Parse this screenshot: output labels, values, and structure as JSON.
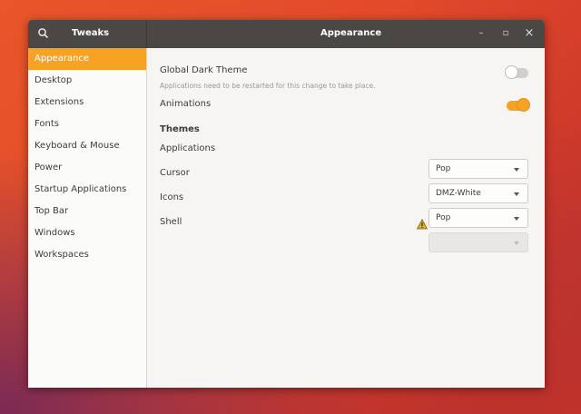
{
  "titlebar": {
    "app_title": "Tweaks",
    "page_title": "Appearance",
    "minimize": "–",
    "maximize": "▫",
    "close": "×"
  },
  "sidebar": {
    "items": [
      {
        "label": "Appearance",
        "active": true
      },
      {
        "label": "Desktop"
      },
      {
        "label": "Extensions"
      },
      {
        "label": "Fonts"
      },
      {
        "label": "Keyboard & Mouse"
      },
      {
        "label": "Power"
      },
      {
        "label": "Startup Applications"
      },
      {
        "label": "Top Bar"
      },
      {
        "label": "Windows"
      },
      {
        "label": "Workspaces"
      }
    ]
  },
  "settings": {
    "dark_theme": {
      "label": "Global Dark Theme",
      "note": "Applications need to be restarted for this change to take place.",
      "enabled": false
    },
    "animations": {
      "label": "Animations",
      "enabled": true
    }
  },
  "themes": {
    "title": "Themes",
    "applications": {
      "label": "Applications",
      "value": "Pop"
    },
    "cursor": {
      "label": "Cursor",
      "value": "DMZ-White"
    },
    "icons": {
      "label": "Icons",
      "value": "Pop"
    },
    "shell": {
      "label": "Shell",
      "value": "",
      "warning_icon": "warning-icon"
    }
  },
  "colors": {
    "accent": "#f6a323",
    "titlebar": "#4a4744"
  }
}
